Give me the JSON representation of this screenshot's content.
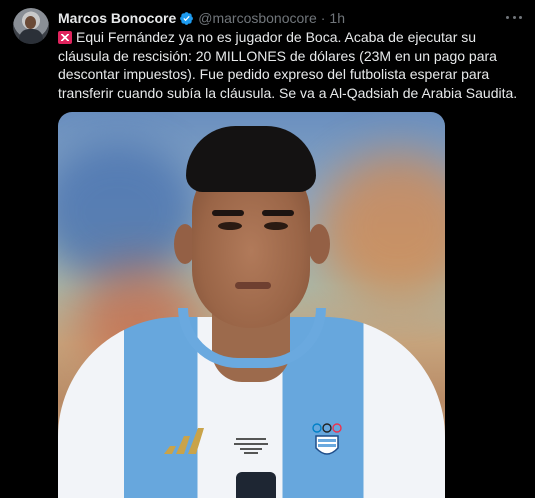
{
  "tweet": {
    "author_name": "Marcos Bonocore",
    "author_handle": "@marcosbonocore",
    "separator": "·",
    "timestamp": "1h",
    "body": "Equi Fernández ya no es jugador de Boca. Acaba de ejecutar su cláusula de rescisión: 20 MILLONES de dólares (23M en un pago para descontar impuestos). Fue pedido expreso del futbolista esperar para transferir cuando subía la cláusula. Se va a Al-Qadsiah de Arabia Saudita.",
    "verified": true,
    "icons": {
      "avatar": "profile-avatar",
      "verified": "verified-badge-icon",
      "more": "more-options-icon",
      "leading_emoji": "red-flag-emoji-icon"
    },
    "colors": {
      "background": "#000000",
      "text": "#e7e9ea",
      "secondary_text": "#71767b",
      "verified": "#1d9bf0",
      "flag": "#e0245e"
    }
  },
  "media": {
    "type": "photo",
    "description_icon": "football-player-photo"
  }
}
